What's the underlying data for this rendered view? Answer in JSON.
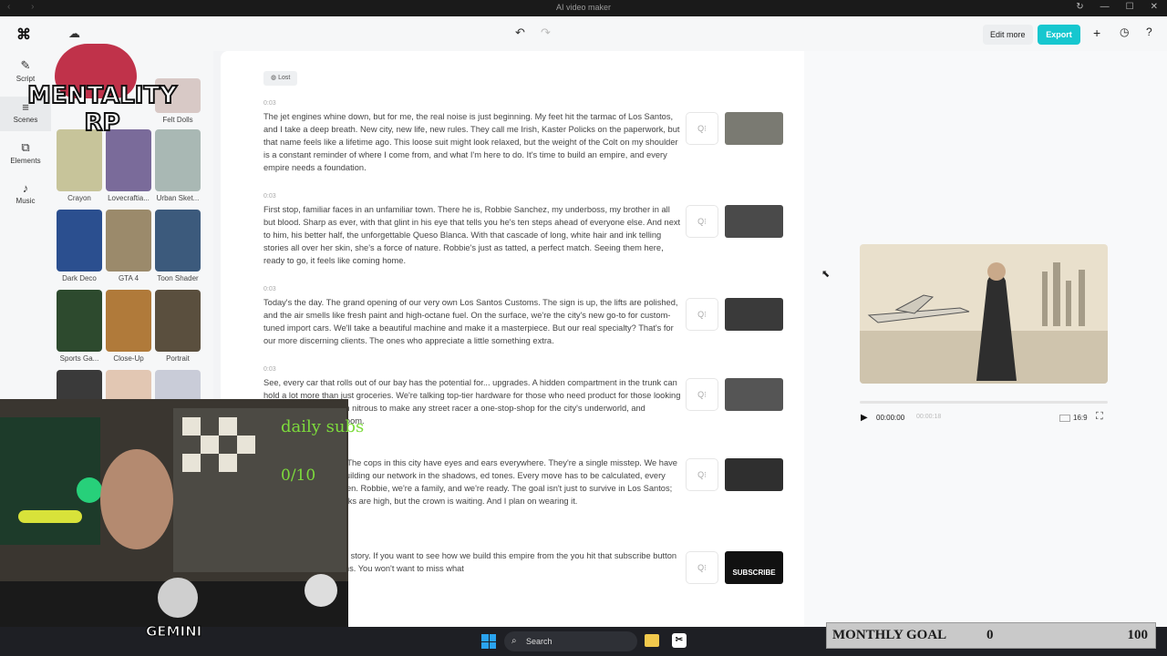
{
  "window": {
    "title": "AI video maker"
  },
  "toolbar": {
    "edit_more": "Edit more",
    "export": "Export"
  },
  "nav": [
    {
      "label": "Script",
      "icon": "script-icon"
    },
    {
      "label": "Scenes",
      "icon": "scenes-icon"
    },
    {
      "label": "Elements",
      "icon": "elements-icon"
    },
    {
      "label": "Music",
      "icon": "music-icon"
    }
  ],
  "styles": [
    {
      "label": "Felt Dolls",
      "color": "#d8c9c6"
    },
    {
      "label": "Crayon",
      "color": "#c7c49a"
    },
    {
      "label": "Lovecraftia...",
      "color": "#7a6b9a"
    },
    {
      "label": "Urban Sket...",
      "color": "#a9b8b4"
    },
    {
      "label": "Dark Deco",
      "color": "#2b4f8f"
    },
    {
      "label": "GTA 4",
      "color": "#9b8a6b"
    },
    {
      "label": "Toon Shader",
      "color": "#3c5a7c"
    },
    {
      "label": "Sports Ga...",
      "color": "#2d4a2e"
    },
    {
      "label": "Close-Up",
      "color": "#b07a3a"
    },
    {
      "label": "Portrait",
      "color": "#5a4f3e"
    }
  ],
  "script": {
    "tag": "Lost",
    "scenes": [
      {
        "time": "0:03",
        "text": "The jet engines whine down, but for me, the real noise is just beginning. My feet hit the tarmac of Los Santos, and I take a deep breath. New city, new life, new rules. They call me Irish, Kaster Policks on the paperwork, but that name feels like a lifetime ago. This loose suit might look relaxed, but the weight of the Colt on my shoulder is a constant reminder of where I come from, and what I'm here to do. It's time to build an empire, and every empire needs a foundation.",
        "thumb_color": "#7a7a72"
      },
      {
        "time": "0:03",
        "text": "First stop, familiar faces in an unfamiliar town. There he is, Robbie Sanchez, my underboss, my brother in all but blood. Sharp as ever, with that glint in his eye that tells you he's ten steps ahead of everyone else. And next to him, his better half, the unforgettable Queso Blanca. With that cascade of long, white hair and ink telling stories all over her skin, she's a force of nature. Robbie's just as tatted, a perfect match. Seeing them here, ready to go, it feels like coming home.",
        "thumb_color": "#4a4a4a"
      },
      {
        "time": "0:03",
        "text": "Today's the day. The grand opening of our very own Los Santos Customs. The sign is up, the lifts are polished, and the air smells like fresh paint and high-octane fuel. On the surface, we're the city's new go-to for custom-tuned import cars. We'll take a beautiful machine and make it a masterpiece. But our real specialty? That's for our more discerning clients. The ones who appreciate a little something extra.",
        "thumb_color": "#3a3a3a"
      },
      {
        "time": "0:03",
        "text": "See, every car that rolls out of our bay has the potential for... upgrades. A hidden compartment in the trunk can hold a lot more than just groceries. We're talking top-tier hardware for those who need product for those looking to escape, and enough nitrous to make any street racer a one-stop-shop for the city's underworld, and business is about to boom.",
        "thumb_color": "#555555"
      },
      {
        "time": "0:03",
        "text": "the top by being loud. The cops in this city have eyes and ears everywhere. They're a single misstep. We have to move like ghosts, building our network in the shadows, ed tones. Every move has to be calculated, every alliance carefully chosen. Robbie, we're a family, and we're ready. The goal isn't just to survive in Los Santos; it's to numental, the risks are high, but the crown is waiting. And I plan on wearing it.",
        "thumb_color": "#2f2f2f"
      },
      {
        "time": "0:03",
        "text": "or the beginning of our story. If you want to see how we build this empire from the you hit that subscribe button and turn on notifications. You won't want to miss what",
        "thumb_color": "#111111",
        "thumb_text": "SUBSCRIBE"
      }
    ]
  },
  "player": {
    "current_time": "00:00:00",
    "duration": "00:00:18",
    "ratio": "16:9",
    "progress": 0
  },
  "taskbar": {
    "search": "Search"
  },
  "overlay": {
    "logo_line1": "MENTALITY",
    "logo_line2": "RP",
    "subs_label": "daily subs",
    "subs_count": "0/10",
    "streamer": "GEMINI",
    "goal_label": "MONTHLY GOAL",
    "goal_current": "0",
    "goal_target": "100"
  }
}
